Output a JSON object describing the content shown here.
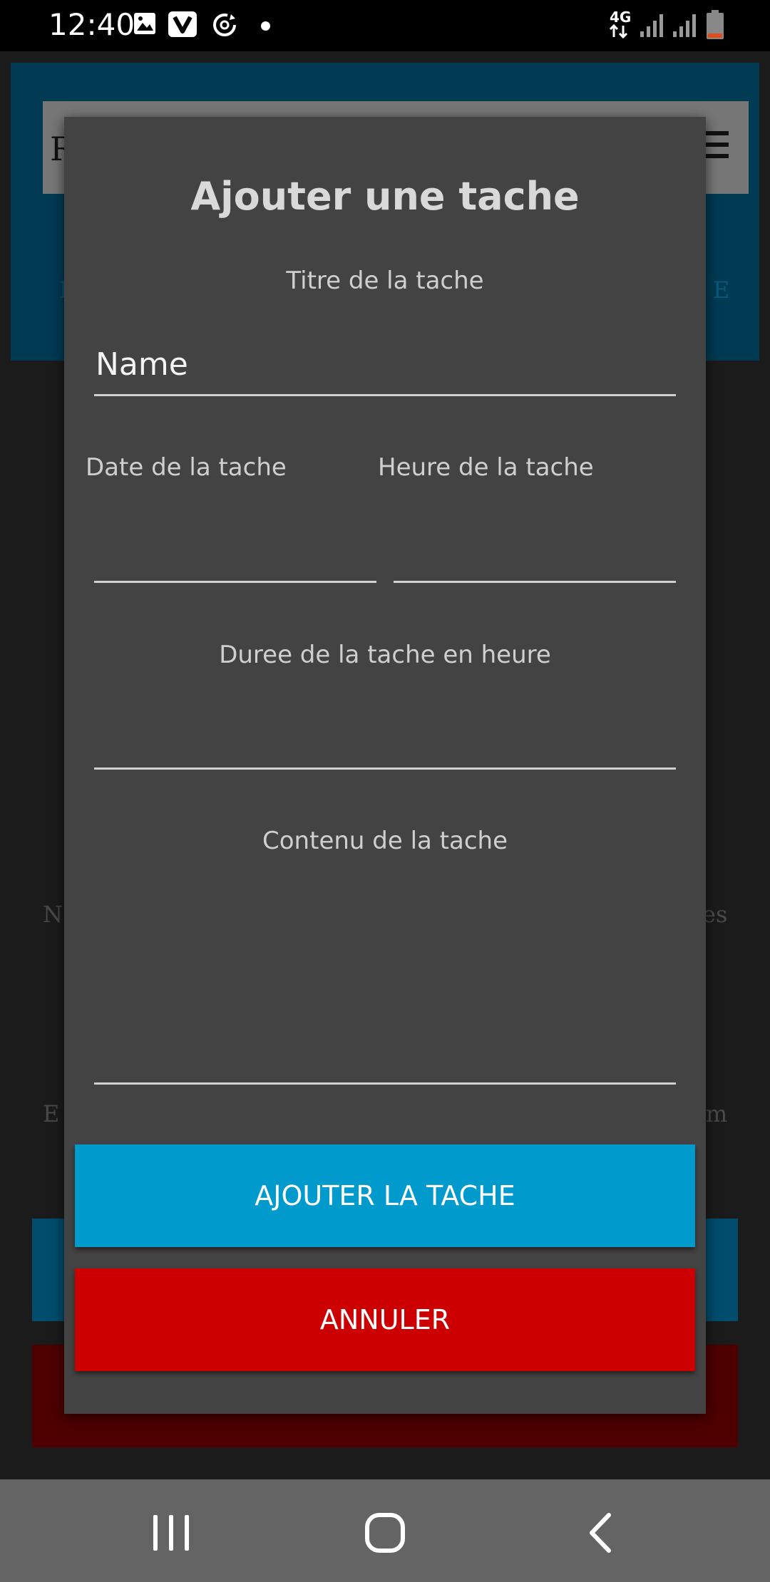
{
  "status_bar": {
    "time": "12:40",
    "network_label": "4G",
    "icons": [
      "image-icon",
      "v-app-icon",
      "sync-icon",
      "notification-dot",
      "signal-icon",
      "signal-icon",
      "battery-low-icon"
    ]
  },
  "background_app": {
    "toolbar_letter": "R",
    "side_texts": [
      "N",
      "E",
      "N",
      "E",
      "es",
      "m"
    ]
  },
  "dialog": {
    "title": "Ajouter une tache",
    "title_field": {
      "label": "Titre de la tache",
      "placeholder": "Name",
      "value": ""
    },
    "date_field": {
      "label": "Date de la tache",
      "value": ""
    },
    "time_field": {
      "label": "Heure de la tache",
      "value": ""
    },
    "duration_field": {
      "label": "Duree de la tache en heure",
      "value": ""
    },
    "content_field": {
      "label": "Contenu de la tache",
      "value": ""
    },
    "add_button_label": "AJOUTER LA TACHE",
    "cancel_button_label": "ANNULER"
  },
  "colors": {
    "primary_button": "#009acd",
    "cancel_button": "#cc0000",
    "dialog_bg": "#434343"
  }
}
